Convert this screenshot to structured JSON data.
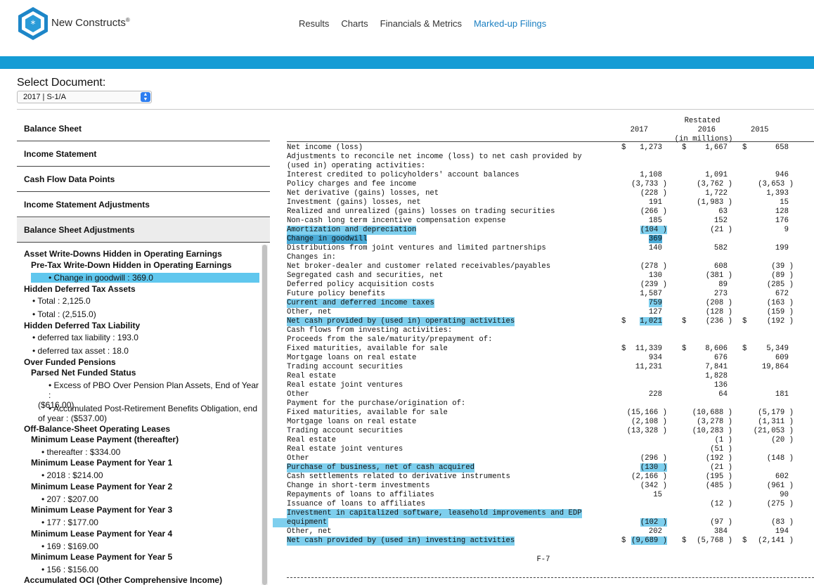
{
  "header": {
    "brand": "New Constructs",
    "registered": "®",
    "nav": [
      {
        "label": "Results",
        "active": false
      },
      {
        "label": "Charts",
        "active": false
      },
      {
        "label": "Financials & Metrics",
        "active": false
      },
      {
        "label": "Marked-up Filings",
        "active": true
      }
    ]
  },
  "select": {
    "label": "Select Document:",
    "value": "2017 | S-1/A"
  },
  "sections": [
    "Balance Sheet",
    "Income Statement",
    "Cash Flow Data Points",
    "Income Statement Adjustments",
    "Balance Sheet Adjustments"
  ],
  "tree": [
    {
      "kind": "h1",
      "text": "Asset Write-Downs Hidden in Operating Earnings"
    },
    {
      "kind": "h2",
      "text": "Pre-Tax Write-Down Hidden in Operating Earnings"
    },
    {
      "kind": "it",
      "text": "• Change in goodwill : 369.0",
      "selected": true,
      "indent": 45
    },
    {
      "kind": "h1",
      "text": "Hidden Deferred Tax Assets"
    },
    {
      "kind": "it",
      "text": "• Total : 2,125.0",
      "indent": 22
    },
    {
      "kind": "it",
      "text": "• Total : (2,515.0)",
      "indent": 22
    },
    {
      "kind": "h1",
      "text": "Hidden Deferred Tax Liability"
    },
    {
      "kind": "it",
      "text": "• deferred tax liability : 193.0",
      "indent": 22
    },
    {
      "kind": "it",
      "text": "• deferred tax asset : 18.0",
      "indent": 22
    },
    {
      "kind": "h1",
      "text": "Over Funded Pensions"
    },
    {
      "kind": "h2",
      "text": "Parsed Net Funded Status"
    },
    {
      "kind": "it2",
      "text": "• Excess of PBO Over Pension Plan Assets, End of Year :",
      "text2": "($616.00)"
    },
    {
      "kind": "it2",
      "text": "• Accumulated Post-Retirement Benefits Obligation, end",
      "text2": "of year : ($537.00)"
    },
    {
      "kind": "h1",
      "text": "Off-Balance-Sheet Operating Leases"
    },
    {
      "kind": "h2",
      "text": "Minimum Lease Payment (thereafter)"
    },
    {
      "kind": "it",
      "text": "• thereafter : $334.00",
      "indent": 35
    },
    {
      "kind": "h2",
      "text": "Minimum Lease Payment for Year 1"
    },
    {
      "kind": "it",
      "text": "• 2018 : $214.00",
      "indent": 35
    },
    {
      "kind": "h2",
      "text": "Minimum Lease Payment for Year 2"
    },
    {
      "kind": "it",
      "text": "• 207 : $207.00",
      "indent": 35
    },
    {
      "kind": "h2",
      "text": "Minimum Lease Payment for Year 3"
    },
    {
      "kind": "it",
      "text": "• 177 : $177.00",
      "indent": 35
    },
    {
      "kind": "h2",
      "text": "Minimum Lease Payment for Year 4"
    },
    {
      "kind": "it",
      "text": "• 169 : $169.00",
      "indent": 35
    },
    {
      "kind": "h2",
      "text": "Minimum Lease Payment for Year 5"
    },
    {
      "kind": "it",
      "text": "• 156 : $156.00",
      "indent": 35
    },
    {
      "kind": "h1",
      "text": "Accumulated OCI (Other Comprehensive Income)"
    }
  ],
  "doc": {
    "restated": "Restated",
    "years": [
      "2017",
      "2016",
      "2015"
    ],
    "in_millions": "(in millions)",
    "page": "F-7",
    "rows": [
      {
        "label": "Net income (loss)",
        "v": [
          "1,273",
          "1,667",
          "658"
        ],
        "d": [
          true,
          true,
          true
        ]
      },
      {
        "label": "Adjustments to reconcile net income (loss) to net cash provided by"
      },
      {
        "label": "(used in) operating activities:"
      },
      {
        "label": "Interest credited to policyholders' account balances",
        "v": [
          "1,108",
          "1,091",
          "946"
        ]
      },
      {
        "label": "Policy charges and fee income",
        "v": [
          "(3,733 )",
          "(3,762 )",
          "(3,653 )"
        ]
      },
      {
        "label": "Net derivative (gains) losses, net",
        "v": [
          "(228 )",
          "1,722",
          "1,393"
        ]
      },
      {
        "label": "Investment (gains) losses, net",
        "v": [
          "191",
          "(1,983 )",
          "15"
        ]
      },
      {
        "label": "Realized and unrealized (gains) losses on trading securities",
        "v": [
          "(266 )",
          "63",
          "128"
        ]
      },
      {
        "label": "Non-cash long term incentive compensation expense",
        "v": [
          "185",
          "152",
          "176"
        ]
      },
      {
        "label": "Amortization and depreciation",
        "v": [
          "(104 )",
          "(21 )",
          "9"
        ],
        "hl": "light"
      },
      {
        "label": "Change in goodwill",
        "v": [
          "369",
          "",
          ""
        ],
        "hl": "dark"
      },
      {
        "label": "Distributions from joint ventures and limited partnerships",
        "v": [
          "140",
          "582",
          "199"
        ]
      },
      {
        "label": "Changes in:"
      },
      {
        "label": "Net broker-dealer and customer related receivables/payables",
        "v": [
          "(278 )",
          "608",
          "(39 )"
        ]
      },
      {
        "label": "Segregated cash and securities, net",
        "v": [
          "130",
          "(381 )",
          "(89 )"
        ]
      },
      {
        "label": "Deferred policy acquisition costs",
        "v": [
          "(239 )",
          "89",
          "(285 )"
        ]
      },
      {
        "label": "Future policy benefits",
        "v": [
          "1,587",
          "273",
          "672"
        ]
      },
      {
        "label": "Current and deferred income taxes",
        "v": [
          "759",
          "(208 )",
          "(163 )"
        ],
        "hl": "light"
      },
      {
        "label": "Other, net",
        "v": [
          "127",
          "(128 )",
          "(159 )"
        ]
      },
      {
        "label": "Net cash provided by (used in) operating activities",
        "v": [
          "1,021",
          "(236 )",
          "(192 )"
        ],
        "d": [
          true,
          true,
          true
        ],
        "hl": "light"
      },
      {
        "label": "Cash flows from investing activities:"
      },
      {
        "label": "Proceeds from the sale/maturity/prepayment of:"
      },
      {
        "label": "Fixed maturities, available for sale",
        "v": [
          "11,339",
          "8,606",
          "5,349"
        ],
        "d": [
          true,
          true,
          true
        ]
      },
      {
        "label": "Mortgage loans on real estate",
        "v": [
          "934",
          "676",
          "609"
        ]
      },
      {
        "label": "Trading account securities",
        "v": [
          "11,231",
          "7,841",
          "19,864"
        ]
      },
      {
        "label": "Real estate",
        "v": [
          "",
          "1,828",
          ""
        ]
      },
      {
        "label": "Real estate joint ventures",
        "v": [
          "",
          "136",
          ""
        ]
      },
      {
        "label": "Other",
        "v": [
          "228",
          "64",
          "181"
        ]
      },
      {
        "label": "Payment for the purchase/origination of:"
      },
      {
        "label": "Fixed maturities, available for sale",
        "v": [
          "(15,166 )",
          "(10,688 )",
          "(5,179 )"
        ]
      },
      {
        "label": "Mortgage loans on real estate",
        "v": [
          "(2,108 )",
          "(3,278 )",
          "(1,311 )"
        ]
      },
      {
        "label": "Trading account securities",
        "v": [
          "(13,328 )",
          "(10,283 )",
          "(21,053 )"
        ]
      },
      {
        "label": "Real estate",
        "v": [
          "",
          "(1 )",
          "(20 )"
        ]
      },
      {
        "label": "Real estate joint ventures",
        "v": [
          "",
          "(51 )",
          ""
        ]
      },
      {
        "label": "Other",
        "v": [
          "(296 )",
          "(192 )",
          "(148 )"
        ]
      },
      {
        "label": "Purchase of business, net of cash acquired",
        "v": [
          "(130 )",
          "(21 )",
          ""
        ],
        "hl": "light"
      },
      {
        "label": "Cash settlements related to derivative instruments",
        "v": [
          "(2,166 )",
          "(195 )",
          "602"
        ]
      },
      {
        "label": "Change in short-term investments",
        "v": [
          "(342 )",
          "(485 )",
          "(961 )"
        ]
      },
      {
        "label": "Repayments of loans to affiliates",
        "v": [
          "15",
          "",
          "90"
        ]
      },
      {
        "label": "Issuance of loans to affiliates",
        "v": [
          "",
          "(12 )",
          "(275 )"
        ]
      },
      {
        "label": "Investment in capitalized software, leasehold improvements and EDP",
        "hl": "light"
      },
      {
        "label": "equipment",
        "v": [
          "(102 )",
          "(97 )",
          "(83 )"
        ],
        "hl": "light",
        "wide": true
      },
      {
        "label": "Other, net",
        "v": [
          "202",
          "384",
          "194"
        ]
      },
      {
        "label": "Net cash provided by (used in) investing activities",
        "v": [
          "(9,689 )",
          "(5,768 )",
          "(2,141 )"
        ],
        "d": [
          true,
          true,
          true
        ],
        "hl": "light"
      }
    ]
  }
}
